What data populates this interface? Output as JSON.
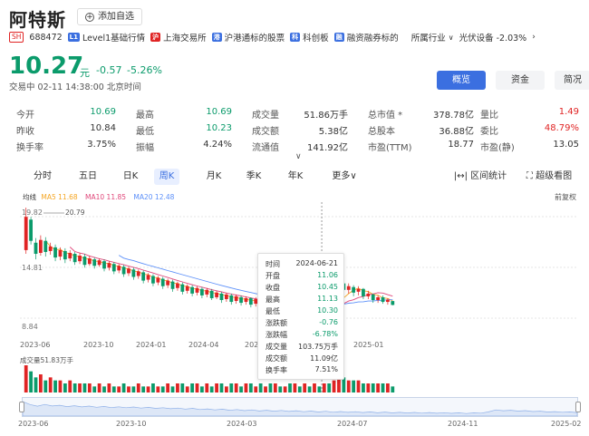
{
  "header": {
    "title": "阿特斯",
    "add_label": "添加自选",
    "exchange_badge": "SH",
    "code": "688472",
    "tags": [
      {
        "label": "Level1基础行情",
        "icon": "level-icon",
        "color": "#3b6fe0",
        "mark": "L1"
      },
      {
        "label": "上海交易所",
        "icon": "shanghai-flag-icon",
        "color": "#e02424",
        "mark": "沪"
      },
      {
        "label": "沪港通标的股票",
        "icon": "hk-connect-icon",
        "color": "#3b6fe0",
        "mark": "港"
      },
      {
        "label": "科创板",
        "icon": "star-market-icon",
        "color": "#3b6fe0",
        "mark": "科"
      },
      {
        "label": "融资融券标的",
        "icon": "margin-icon",
        "color": "#3b6fe0",
        "mark": "融"
      }
    ],
    "industry_label": "所属行业",
    "industry_value": "光伏设备 -2.03%"
  },
  "quote": {
    "price": "10.27",
    "unit": "元",
    "change": "-0.57",
    "change_pct": "-5.26%",
    "status": "交易中 02-11 14:38:00 北京时间"
  },
  "tabs": [
    "概览",
    "资金",
    "简况"
  ],
  "stats": [
    [
      {
        "label": "今开",
        "value": "10.69",
        "color": "#0b9b6b"
      },
      {
        "label": "最高",
        "value": "10.69",
        "color": "#0b9b6b"
      },
      {
        "label": "成交量",
        "value": "51.86万手",
        "color": "#333"
      },
      {
        "label": "总市值",
        "value": "378.78亿",
        "color": "#333",
        "star": "*"
      },
      {
        "label": "量比",
        "value": "1.49",
        "color": "#e02424"
      }
    ],
    [
      {
        "label": "昨收",
        "value": "10.84",
        "color": "#333"
      },
      {
        "label": "最低",
        "value": "10.23",
        "color": "#0b9b6b"
      },
      {
        "label": "成交额",
        "value": "5.38亿",
        "color": "#333"
      },
      {
        "label": "总股本",
        "value": "36.88亿",
        "color": "#333"
      },
      {
        "label": "委比",
        "value": "48.79%",
        "color": "#e02424"
      }
    ],
    [
      {
        "label": "换手率",
        "value": "3.75%",
        "color": "#333"
      },
      {
        "label": "振幅",
        "value": "4.24%",
        "color": "#333"
      },
      {
        "label": "流通值",
        "value": "141.92亿",
        "color": "#333"
      },
      {
        "label": "市盈(TTM)",
        "value": "18.77",
        "color": "#333"
      },
      {
        "label": "市盈(静)",
        "value": "13.05",
        "color": "#333"
      }
    ]
  ],
  "periods": [
    "分时",
    "五日",
    "日K",
    "周K",
    "月K",
    "季K",
    "年K",
    "更多"
  ],
  "active_period": "周K",
  "tools": {
    "interval": "区间统计",
    "super": "超级看图"
  },
  "ma": {
    "label": "均线",
    "ma5": "MA5 11.68",
    "ma10": "MA10 11.85",
    "ma20": "MA20 12.48",
    "colors": {
      "ma5": "#f5a623",
      "ma10": "#e0477a",
      "ma20": "#5b8ff9"
    }
  },
  "adjust": "前复权",
  "chart_data": {
    "type": "candlestick",
    "period": "weekly",
    "ylim": [
      8.84,
      19.82
    ],
    "y_labels": [
      "19.82",
      "14.81",
      "8.84"
    ],
    "max_annotation": "20.79",
    "x_labels": [
      "2023-06",
      "2023-10",
      "2024-01",
      "2024-04",
      "2024-07",
      "2024-10",
      "2025-01"
    ],
    "volume_label": "成交量51.83万手",
    "candles": [
      [
        16.2,
        19.8,
        20.79,
        15.8
      ],
      [
        19.5,
        17.2,
        19.8,
        16.8
      ],
      [
        17.0,
        15.8,
        17.5,
        15.2
      ],
      [
        15.9,
        17.3,
        17.8,
        15.6
      ],
      [
        17.2,
        16.0,
        17.6,
        15.5
      ],
      [
        16.1,
        16.6,
        17.0,
        15.7
      ],
      [
        16.5,
        15.4,
        16.8,
        15.0
      ],
      [
        15.5,
        16.2,
        16.5,
        15.1
      ],
      [
        16.1,
        15.2,
        16.4,
        14.8
      ],
      [
        15.3,
        15.9,
        16.2,
        15.0
      ],
      [
        15.8,
        14.9,
        16.0,
        14.6
      ],
      [
        15.0,
        15.6,
        15.9,
        14.7
      ],
      [
        15.5,
        14.6,
        15.8,
        14.3
      ],
      [
        14.7,
        15.3,
        15.6,
        14.5
      ],
      [
        15.2,
        14.5,
        15.4,
        14.2
      ],
      [
        14.6,
        15.1,
        15.3,
        14.4
      ],
      [
        15.0,
        14.2,
        15.2,
        13.9
      ],
      [
        14.3,
        14.8,
        15.0,
        14.0
      ],
      [
        14.7,
        13.9,
        14.9,
        13.6
      ],
      [
        14.0,
        14.5,
        14.7,
        13.7
      ],
      [
        14.4,
        13.6,
        14.6,
        13.3
      ],
      [
        13.7,
        14.2,
        14.4,
        13.4
      ],
      [
        14.1,
        13.3,
        14.3,
        13.0
      ],
      [
        13.4,
        13.9,
        14.1,
        13.1
      ],
      [
        13.8,
        12.9,
        14.0,
        12.6
      ],
      [
        13.0,
        13.5,
        13.7,
        12.7
      ],
      [
        13.4,
        12.6,
        13.6,
        12.3
      ],
      [
        12.7,
        13.2,
        13.4,
        12.4
      ],
      [
        13.1,
        12.3,
        13.3,
        12.0
      ],
      [
        12.4,
        12.9,
        13.1,
        12.1
      ],
      [
        12.8,
        12.0,
        13.0,
        11.7
      ],
      [
        12.1,
        12.6,
        12.8,
        11.8
      ],
      [
        12.5,
        11.7,
        12.7,
        11.4
      ],
      [
        11.8,
        12.3,
        12.5,
        11.5
      ],
      [
        12.2,
        11.5,
        12.4,
        11.2
      ],
      [
        11.6,
        12.1,
        12.3,
        11.3
      ],
      [
        12.0,
        11.3,
        12.2,
        11.0
      ],
      [
        11.4,
        11.9,
        12.1,
        11.1
      ],
      [
        11.8,
        11.0,
        12.0,
        10.8
      ],
      [
        11.1,
        11.6,
        11.8,
        10.9
      ],
      [
        11.5,
        10.8,
        11.7,
        10.5
      ],
      [
        10.9,
        11.4,
        11.6,
        10.6
      ],
      [
        11.3,
        10.6,
        11.5,
        10.3
      ],
      [
        10.7,
        11.2,
        11.4,
        10.4
      ],
      [
        11.1,
        10.5,
        11.3,
        10.2
      ],
      [
        10.6,
        11.0,
        11.2,
        10.3
      ],
      [
        11.0,
        10.3,
        11.1,
        10.0
      ],
      [
        10.4,
        10.9,
        11.1,
        10.1
      ],
      [
        10.8,
        10.1,
        11.0,
        9.8
      ],
      [
        10.2,
        10.7,
        10.9,
        9.9
      ],
      [
        10.6,
        10.0,
        10.8,
        9.7
      ],
      [
        10.1,
        10.5,
        10.7,
        9.8
      ],
      [
        10.4,
        9.9,
        10.6,
        9.6
      ],
      [
        10.0,
        10.4,
        10.6,
        9.7
      ],
      [
        10.3,
        9.8,
        10.5,
        9.5
      ],
      [
        9.9,
        10.3,
        10.5,
        9.6
      ],
      [
        10.2,
        9.7,
        10.4,
        9.4
      ],
      [
        9.8,
        10.2,
        10.4,
        9.5
      ],
      [
        10.1,
        9.6,
        10.3,
        9.3
      ],
      [
        9.7,
        10.1,
        10.3,
        9.4
      ],
      [
        10.0,
        9.5,
        10.2,
        9.2
      ],
      [
        9.6,
        10.0,
        10.2,
        9.3
      ],
      [
        10.0,
        9.8,
        10.1,
        9.4
      ],
      [
        9.9,
        10.9,
        11.2,
        9.7
      ],
      [
        10.9,
        12.6,
        13.3,
        10.7
      ],
      [
        12.6,
        11.9,
        12.9,
        11.6
      ],
      [
        11.9,
        12.3,
        12.6,
        11.5
      ],
      [
        12.2,
        11.6,
        12.4,
        11.2
      ],
      [
        11.7,
        12.0,
        12.3,
        11.3
      ],
      [
        12.0,
        11.2,
        12.1,
        10.9
      ],
      [
        11.2,
        11.5,
        11.8,
        10.9
      ],
      [
        11.4,
        10.8,
        11.5,
        10.5
      ],
      [
        10.8,
        11.1,
        11.3,
        10.5
      ],
      [
        11.1,
        10.6,
        11.3,
        10.4
      ],
      [
        10.6,
        10.84,
        11.0,
        10.3
      ],
      [
        10.69,
        10.27,
        10.69,
        10.23
      ]
    ],
    "volume": [
      9,
      7,
      5,
      6,
      4,
      5,
      4,
      4,
      3,
      4,
      3,
      3,
      3,
      3,
      2,
      3,
      2,
      3,
      2,
      2,
      3,
      2,
      2,
      3,
      2,
      2,
      3,
      2,
      2,
      3,
      2,
      3,
      3,
      2,
      3,
      3,
      2,
      3,
      2,
      3,
      3,
      2,
      3,
      3,
      2,
      3,
      3,
      2,
      3,
      2,
      3,
      3,
      2,
      2,
      3,
      3,
      2,
      3,
      2,
      3,
      2,
      3,
      3,
      4,
      6,
      5,
      4,
      4,
      4,
      3,
      3,
      3,
      3,
      3,
      3,
      2
    ]
  },
  "tooltip": [
    {
      "k": "时间",
      "v": "2024-06-21",
      "c": "#333"
    },
    {
      "k": "开盘",
      "v": "11.06",
      "c": "#0b9b6b"
    },
    {
      "k": "收盘",
      "v": "10.45",
      "c": "#0b9b6b"
    },
    {
      "k": "最高",
      "v": "11.13",
      "c": "#0b9b6b"
    },
    {
      "k": "最低",
      "v": "10.30",
      "c": "#0b9b6b"
    },
    {
      "k": "涨跌额",
      "v": "-0.76",
      "c": "#0b9b6b"
    },
    {
      "k": "涨跌幅",
      "v": "-6.78%",
      "c": "#0b9b6b"
    },
    {
      "k": "成交量",
      "v": "103.75万手",
      "c": "#333"
    },
    {
      "k": "成交额",
      "v": "11.09亿",
      "c": "#333"
    },
    {
      "k": "换手率",
      "v": "7.51%",
      "c": "#333"
    }
  ],
  "nav_x_labels": [
    "2023-06",
    "2023-10",
    "2024-03",
    "2024-07",
    "2024-11",
    "2025-02"
  ]
}
